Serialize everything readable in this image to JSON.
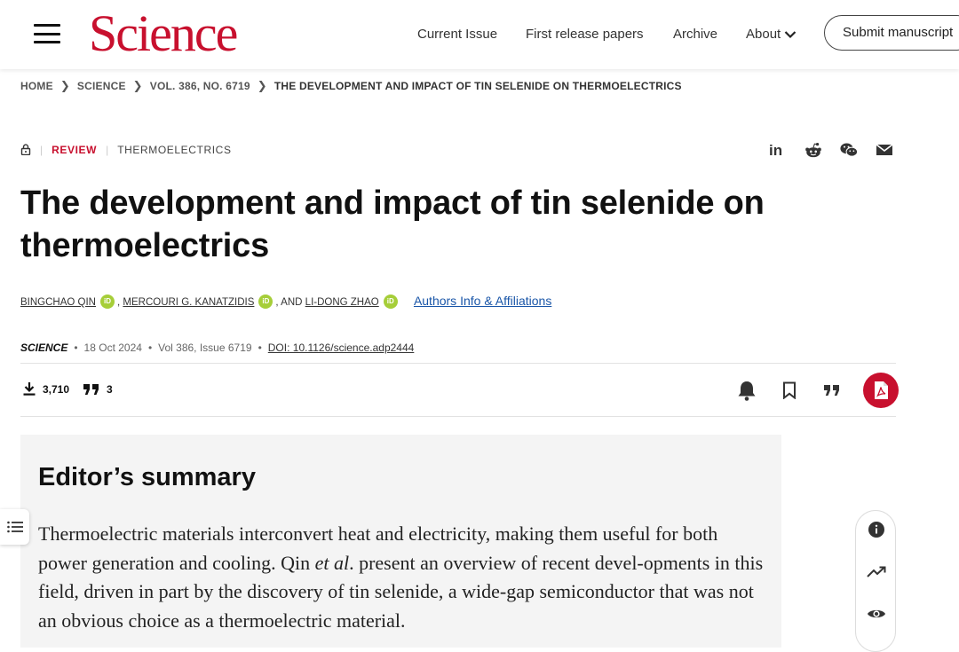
{
  "header": {
    "logo": "Science",
    "nav": [
      "Current Issue",
      "First release papers",
      "Archive",
      "About"
    ],
    "submit": "Submit manuscript"
  },
  "breadcrumb": [
    "HOME",
    "SCIENCE",
    "VOL. 386, NO. 6719",
    "THE DEVELOPMENT AND IMPACT OF TIN SELENIDE ON THERMOELECTRICS"
  ],
  "article": {
    "type": "REVIEW",
    "topic": "THERMOELECTRICS",
    "title": "The development and impact of tin selenide on thermoelectrics",
    "authors": [
      "BINGCHAO QIN",
      "MERCOURI G. KANATZIDIS",
      "LI-DONG ZHAO"
    ],
    "and_text": ", AND",
    "comma": ",",
    "orcid_label": "iD",
    "affiliations_link": "Authors Info & Affiliations",
    "journal": "SCIENCE",
    "date": "18 Oct 2024",
    "volume": "Vol 386, Issue 6719",
    "doi": "DOI: 10.1126/science.adp2444",
    "downloads": "3,710",
    "citations": "3"
  },
  "summary": {
    "heading": "Editor’s summary",
    "text_before": "Thermoelectric materials interconvert heat and electricity, making them useful for both power generation and cooling. Qin ",
    "text_italic": "et al",
    "text_after": ". present an overview of recent devel-opments in this field, driven in part by the discovery of tin selenide, a wide-gap semiconductor that was not an obvious choice as a thermoelectric material."
  },
  "icons": {
    "share": [
      "linkedin-icon",
      "reddit-icon",
      "wechat-icon",
      "email-icon"
    ],
    "actions": [
      "bell-icon",
      "bookmark-icon",
      "cite-icon",
      "pdf-icon"
    ],
    "rail": [
      "info-icon",
      "trending-icon",
      "eye-icon"
    ]
  },
  "colors": {
    "brand": "#c8102e",
    "link": "#1a56a8",
    "orcid": "#a6ce39"
  }
}
